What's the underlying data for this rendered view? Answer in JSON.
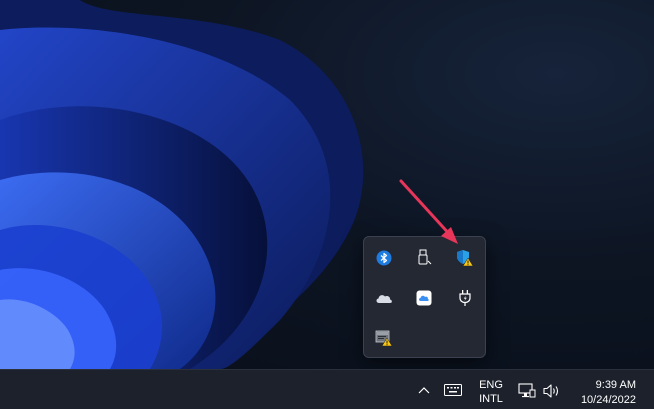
{
  "taskbar": {
    "language": {
      "line1": "ENG",
      "line2": "INTL"
    },
    "clock": {
      "time": "9:39 AM",
      "date": "10/24/2022"
    }
  },
  "tray_flyout": {
    "icons": [
      "bluetooth-icon",
      "usb-safely-remove-icon",
      "windows-security-warning-icon",
      "onedrive-icon",
      "icloud-icon",
      "power-plug-icon",
      "vmware-warning-icon"
    ]
  },
  "colors": {
    "taskbar": "#1c212b",
    "flyout": "#232832",
    "annotation_arrow": "#e8355a",
    "warning_badge": "#f7c613",
    "bluetooth": "#1e7be0"
  }
}
